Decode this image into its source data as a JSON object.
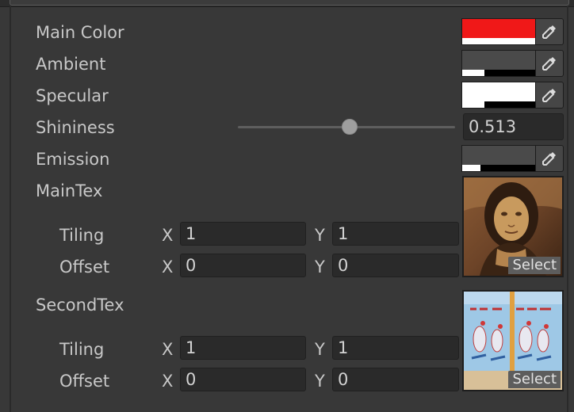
{
  "properties": {
    "main_color": {
      "label": "Main Color",
      "color": "#f01818",
      "alpha": 1.0
    },
    "ambient": {
      "label": "Ambient",
      "color": "#4a4a4a",
      "alpha": 0.3
    },
    "specular": {
      "label": "Specular",
      "color": "#ffffff",
      "alpha": 0.3
    },
    "shininess": {
      "label": "Shininess",
      "value": "0.513",
      "slider_fraction": 0.513
    },
    "emission": {
      "label": "Emission",
      "color": "#4a4a4a",
      "alpha": 0.25
    }
  },
  "main_tex": {
    "label": "MainTex",
    "tiling": {
      "label": "Tiling",
      "x_label": "X",
      "x": "1",
      "y_label": "Y",
      "y": "1"
    },
    "offset": {
      "label": "Offset",
      "x_label": "X",
      "x": "0",
      "y_label": "Y",
      "y": "0"
    },
    "select_label": "Select"
  },
  "second_tex": {
    "label": "SecondTex",
    "tiling": {
      "label": "Tiling",
      "x_label": "X",
      "x": "1",
      "y_label": "Y",
      "y": "1"
    },
    "offset": {
      "label": "Offset",
      "x_label": "X",
      "x": "0",
      "y_label": "Y",
      "y": "0"
    },
    "select_label": "Select"
  },
  "icons": {
    "color_picker": "eyedropper-icon"
  }
}
